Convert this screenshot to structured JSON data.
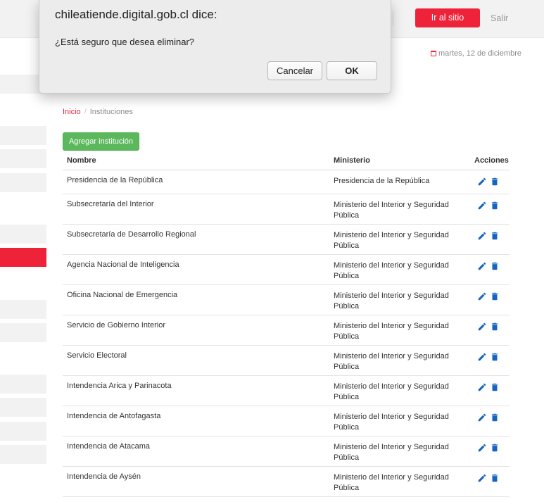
{
  "header": {
    "visit_site_label": "Ir al sitio",
    "logout_label": "Salir"
  },
  "date_text": "martes, 12 de diciembre",
  "breadcrumb": {
    "home": "Inicio",
    "separator": "/",
    "current": "Instituciones"
  },
  "add_button_label": "Agregar institución",
  "table": {
    "headers": [
      "Nombre",
      "Ministerio",
      "Acciones"
    ],
    "rows": [
      {
        "name": "Presidencia de la República",
        "ministry": "Presidencia de la República"
      },
      {
        "name": "Subsecretaría del Interior",
        "ministry": "Ministerio del Interior y Seguridad Pública"
      },
      {
        "name": "Subsecretaría de Desarrollo Regional",
        "ministry": "Ministerio del Interior y Seguridad Pública"
      },
      {
        "name": "Agencia Nacional de Inteligencia",
        "ministry": "Ministerio del Interior y Seguridad Pública"
      },
      {
        "name": "Oficina Nacional de Emergencia",
        "ministry": "Ministerio del Interior y Seguridad Pública"
      },
      {
        "name": "Servicio de Gobierno Interior",
        "ministry": "Ministerio del Interior y Seguridad Pública"
      },
      {
        "name": "Servicio Electoral",
        "ministry": "Ministerio del Interior y Seguridad Pública"
      },
      {
        "name": "Intendencia Arica y Parinacota",
        "ministry": "Ministerio del Interior y Seguridad Pública"
      },
      {
        "name": "Intendencia de Antofagasta",
        "ministry": "Ministerio del Interior y Seguridad Pública"
      },
      {
        "name": "Intendencia de Atacama",
        "ministry": "Ministerio del Interior y Seguridad Pública"
      },
      {
        "name": "Intendencia de Aysén",
        "ministry": "Ministerio del Interior y Seguridad Pública"
      }
    ]
  },
  "dialog": {
    "title": "chileatiende.digital.gob.cl dice:",
    "message": "¿Está seguro que desea eliminar?",
    "cancel_label": "Cancelar",
    "ok_label": "OK"
  },
  "colors": {
    "accent": "#ee2238",
    "success": "#5cb85c",
    "icon_blue": "#1565c0"
  },
  "icons": {
    "calendar": "calendar-icon",
    "edit": "pencil-icon",
    "delete": "trash-icon"
  }
}
